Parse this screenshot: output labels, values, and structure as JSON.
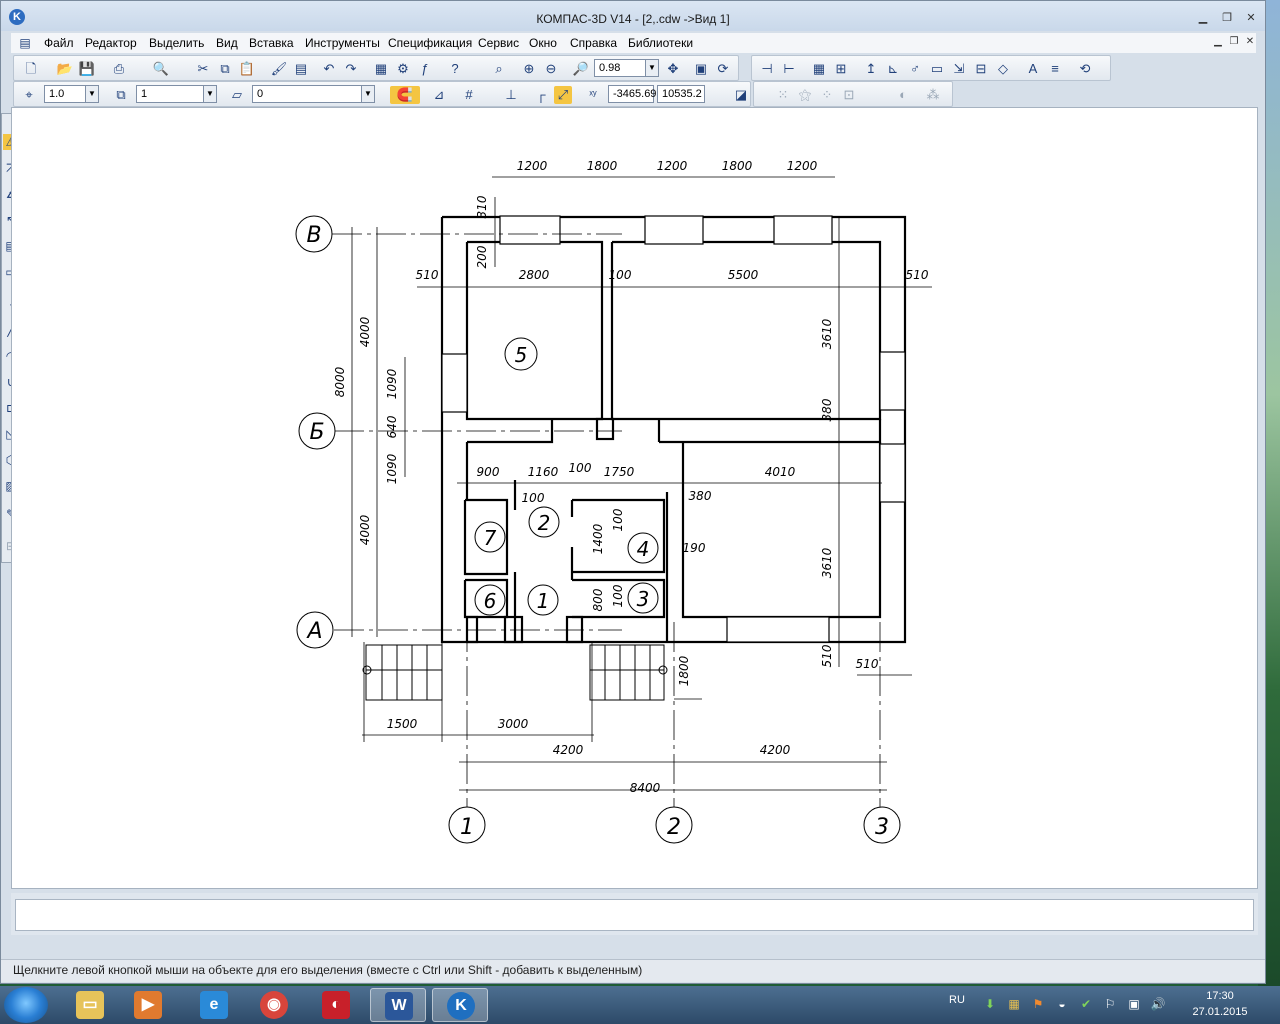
{
  "window": {
    "title": "КОМПАС-3D V14 - [2,.cdw ->Вид 1]"
  },
  "menu": [
    "Файл",
    "Редактор",
    "Выделить",
    "Вид",
    "Вставка",
    "Инструменты",
    "Спецификация",
    "Сервис",
    "Окно",
    "Справка",
    "Библиотеки"
  ],
  "toolbar": {
    "zoom": "0.98",
    "step": "1.0",
    "layer": "1",
    "style": "0",
    "coord_x": "-3465.69",
    "coord_y": "10535.2"
  },
  "drawing": {
    "axis_labels": {
      "v": "В",
      "b": "Б",
      "a": "А",
      "c1": "1",
      "c2": "2",
      "c3": "3"
    },
    "rooms": [
      "5",
      "7",
      "2",
      "4",
      "6",
      "1",
      "3"
    ],
    "dimensions": {
      "top": [
        "1200",
        "1800",
        "1200",
        "1800",
        "1200"
      ],
      "row2": [
        "510",
        "2800",
        "100",
        "5500",
        "510"
      ],
      "mid": [
        "900",
        "1160",
        "100",
        "1750",
        "4010"
      ],
      "left_total": "8000",
      "left_a": "4000",
      "left_b": "4000",
      "left_1090a": "1090",
      "left_640": "640",
      "left_1090b": "1090",
      "d310": "310",
      "d200": "200",
      "right_3610a": "3610",
      "right_380": "380",
      "right_3610b": "3610",
      "right_510": "510",
      "d380": "380",
      "d190": "190",
      "d100b": "100",
      "d1400": "1400",
      "d100c": "100",
      "d100d": "100",
      "d800": "800",
      "bottom_1500": "1500",
      "bottom_3000": "3000",
      "bottom_4200a": "4200",
      "bottom_4200b": "4200",
      "bottom_8400": "8400",
      "d1800": "1800",
      "bottom_510": "510"
    }
  },
  "status": "Щелкните левой кнопкой мыши на объекте для его выделения (вместе с Ctrl или Shift - добавить к выделенным)",
  "taskbar": {
    "lang": "RU",
    "time": "17:30",
    "date": "27.01.2015"
  }
}
